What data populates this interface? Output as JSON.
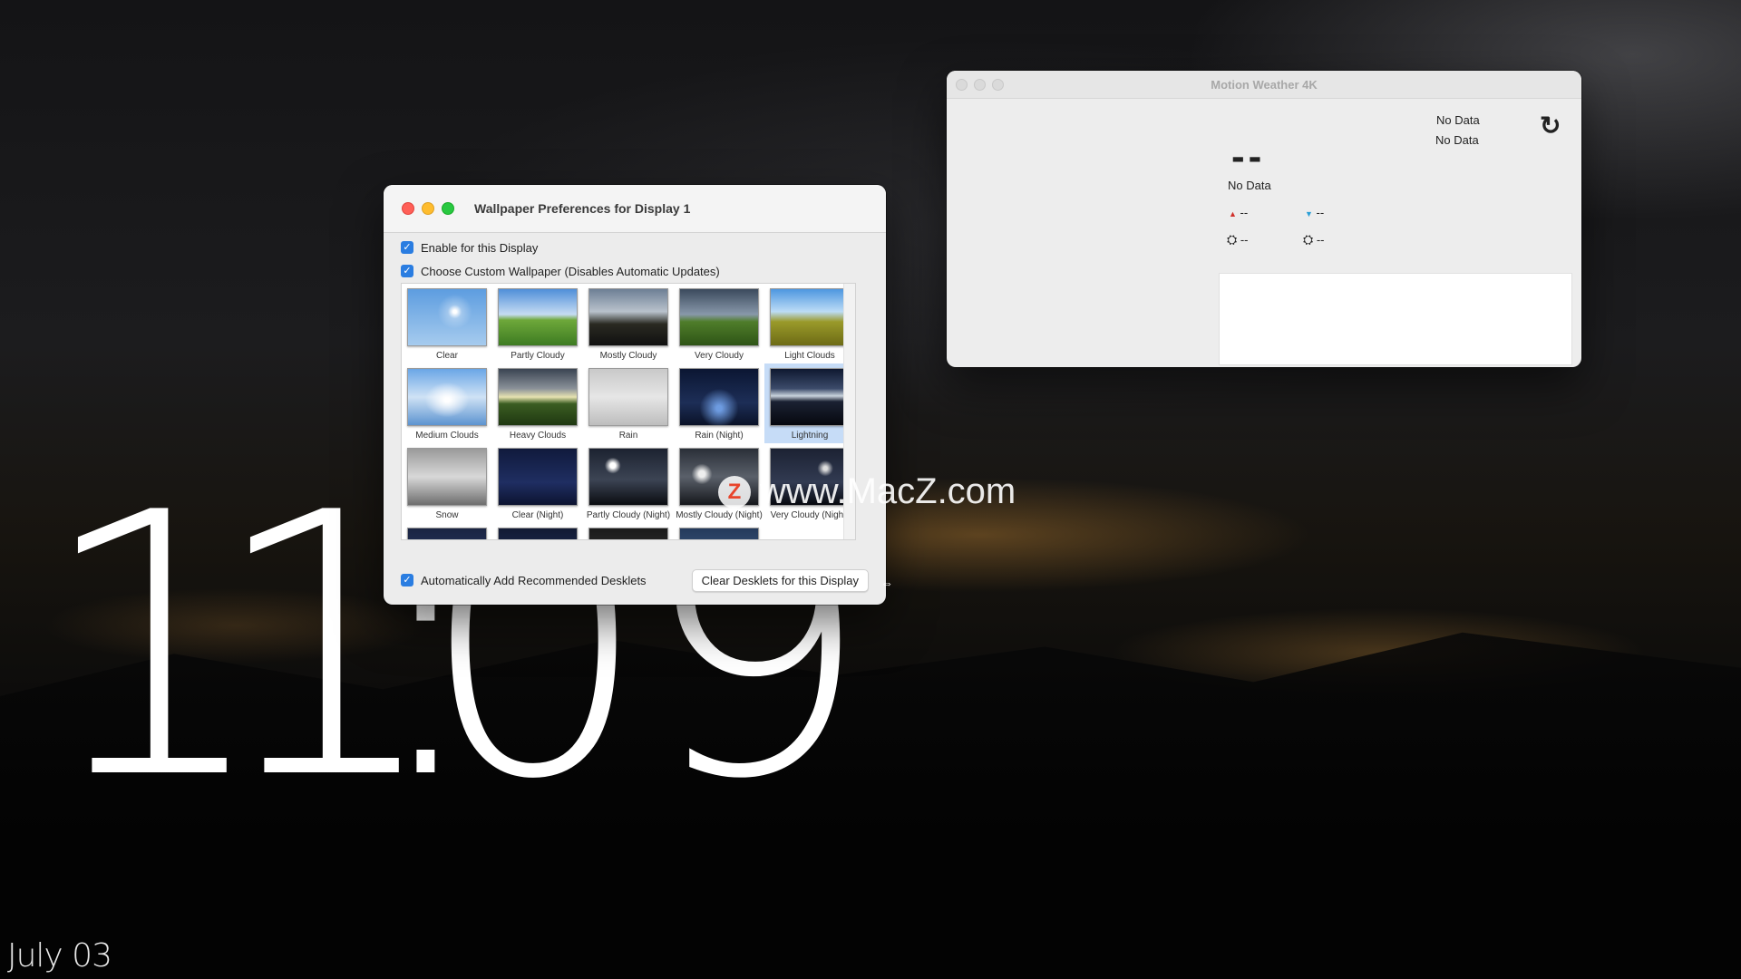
{
  "desktop": {
    "clock": {
      "h1": "1",
      "h2": "1",
      "sep": ":",
      "m1": "0",
      "m2": "9"
    },
    "date": "July 03",
    "watermark": {
      "logo": "Z",
      "text": "www.MacZ.com"
    }
  },
  "prefs_window": {
    "title": "Wallpaper Preferences for Display 1",
    "enable_label": "Enable for this Display",
    "custom_label": "Choose Custom Wallpaper (Disables Automatic Updates)",
    "auto_label": "Automatically Add Recommended Desklets",
    "clear_button": "Clear Desklets for this Display",
    "selected_tile": "Lightning",
    "tiles": [
      {
        "label": "Clear"
      },
      {
        "label": "Partly Cloudy"
      },
      {
        "label": "Mostly Cloudy"
      },
      {
        "label": "Very Cloudy"
      },
      {
        "label": "Light Clouds"
      },
      {
        "label": "Medium Clouds"
      },
      {
        "label": "Heavy Clouds"
      },
      {
        "label": "Rain"
      },
      {
        "label": "Rain (Night)"
      },
      {
        "label": "Lightning"
      },
      {
        "label": "Snow"
      },
      {
        "label": "Clear (Night)"
      },
      {
        "label": "Partly Cloudy (Night)"
      },
      {
        "label": "Mostly Cloudy (Night)"
      },
      {
        "label": "Very Cloudy (Night)"
      }
    ]
  },
  "weather_window": {
    "title": "Motion Weather 4K",
    "line1": "No Data",
    "line2": "No Data",
    "temp": "--",
    "condition": "No Data",
    "high": "--",
    "low": "--",
    "sunrise": "--",
    "sunset": "--",
    "refresh_icon": "↻"
  },
  "colors": {
    "accent": "#2a7de1",
    "selection": "#c6dcf7"
  }
}
